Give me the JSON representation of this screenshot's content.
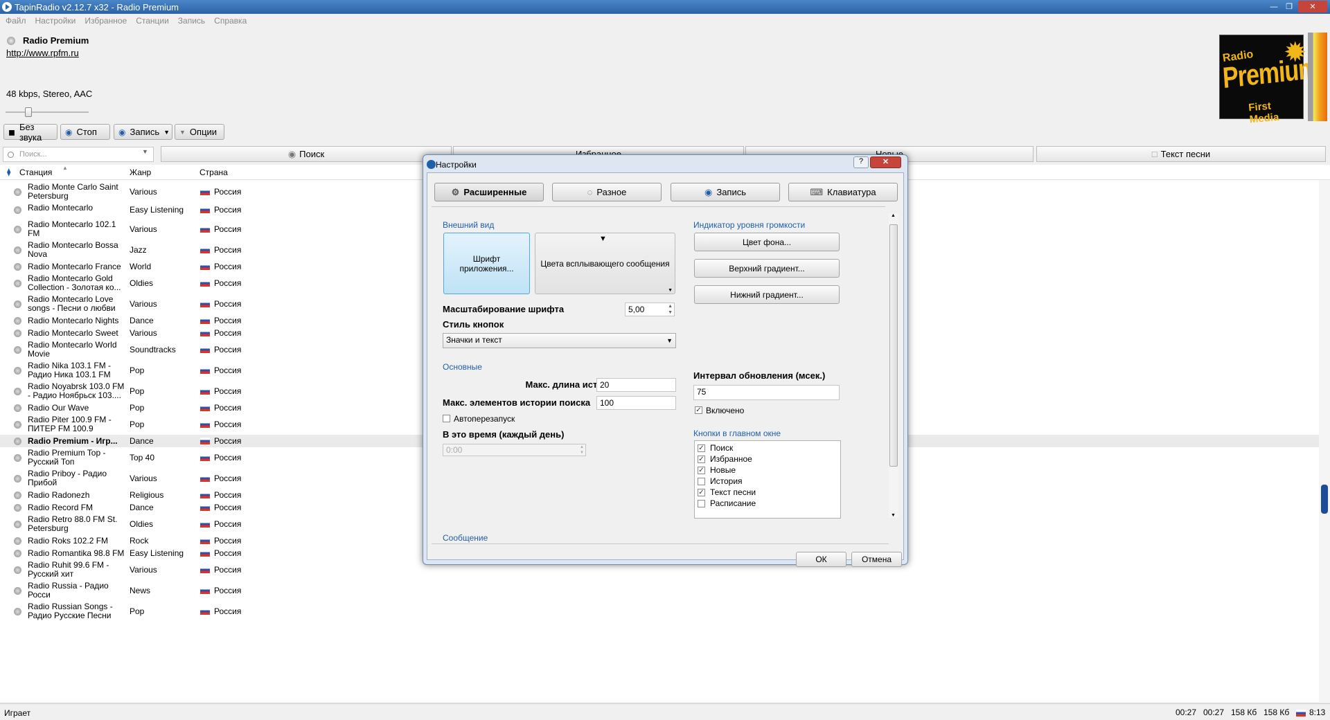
{
  "window": {
    "title": "TapinRadio v2.12.7 x32 - Radio Premium"
  },
  "menu": [
    "Файл",
    "Настройки",
    "Избранное",
    "Станции",
    "Запись",
    "Справка"
  ],
  "station": {
    "name": "Radio Premium",
    "url": "http://www.rpfm.ru",
    "format": "48 kbps, Stereo, AAC"
  },
  "logo": {
    "line1": "Radio",
    "line2": "Premium",
    "line3": "First Media"
  },
  "toolbar": {
    "mute": "Без звука",
    "stop": "Стоп",
    "record": "Запись",
    "options": "Опции"
  },
  "search": {
    "placeholder": "Поиск..."
  },
  "tabs": {
    "search": "Поиск",
    "favorites": "Избранное",
    "new": "Новые",
    "lyrics": "Текст песни"
  },
  "list": {
    "headers": {
      "station": "Станция",
      "genre": "Жанр",
      "country": "Страна"
    },
    "rows": [
      {
        "station": "Radio Monte Carlo Saint Petersburg",
        "genre": "Various",
        "country": "Россия"
      },
      {
        "station": "Radio Montecarlo",
        "genre": "Easy Listening",
        "country": "Россия"
      },
      {
        "station": "Radio Montecarlo 102.1 FM",
        "genre": "Various",
        "country": "Россия"
      },
      {
        "station": "Radio Montecarlo Bossa Nova",
        "genre": "Jazz",
        "country": "Россия"
      },
      {
        "station": "Radio Montecarlo France",
        "genre": "World",
        "country": "Россия"
      },
      {
        "station": "Radio Montecarlo Gold Collection - Золотая ко...",
        "genre": "Oldies",
        "country": "Россия"
      },
      {
        "station": "Radio Montecarlo Love songs - Песни о любви",
        "genre": "Various",
        "country": "Россия"
      },
      {
        "station": "Radio Montecarlo Nights",
        "genre": "Dance",
        "country": "Россия"
      },
      {
        "station": "Radio Montecarlo Sweet",
        "genre": "Various",
        "country": "Россия"
      },
      {
        "station": "Radio Montecarlo World Movie",
        "genre": "Soundtracks",
        "country": "Россия"
      },
      {
        "station": "Radio Nika 103.1 FM - Радио Ника 103.1 FM",
        "genre": "Pop",
        "country": "Россия"
      },
      {
        "station": "Radio Noyabrsk 103.0 FM - Радио Ноябрьск 103....",
        "genre": "Pop",
        "country": "Россия"
      },
      {
        "station": "Radio Our Wave",
        "genre": "Pop",
        "country": "Россия"
      },
      {
        "station": "Radio Piter 100.9 FM - ПИТЕР FM 100.9",
        "genre": "Pop",
        "country": "Россия"
      },
      {
        "station": "Radio Premium - Игр...",
        "genre": "Dance",
        "country": "Россия"
      },
      {
        "station": "Radio Premium Top - Русский Топ",
        "genre": "Top 40",
        "country": "Россия"
      },
      {
        "station": "Radio Priboy - Радио Прибой",
        "genre": "Various",
        "country": "Россия"
      },
      {
        "station": "Radio Radonezh",
        "genre": "Religious",
        "country": "Россия"
      },
      {
        "station": "Radio Record FM",
        "genre": "Dance",
        "country": "Россия"
      },
      {
        "station": "Radio Retro 88.0 FM St. Petersburg",
        "genre": "Oldies",
        "country": "Россия"
      },
      {
        "station": "Radio Roks 102.2 FM",
        "genre": "Rock",
        "country": "Россия"
      },
      {
        "station": "Radio Romantika 98.8 FM",
        "genre": "Easy Listening",
        "country": "Россия"
      },
      {
        "station": "Radio Ruhit 99.6 FM - Русский хит",
        "genre": "Various",
        "country": "Россия"
      },
      {
        "station": "Radio Russia - Радио Росси",
        "genre": "News",
        "country": "Россия"
      },
      {
        "station": "Radio Russian Songs - Радио Русские Песни",
        "genre": "Pop",
        "country": "Россия"
      }
    ]
  },
  "status": {
    "text": "Играет",
    "time1": "00:27",
    "time2": "00:27",
    "size1": "158 Кб",
    "size2": "158 Кб",
    "clock": "8:13"
  },
  "dialog": {
    "title": "Настройки",
    "help": "?",
    "tabs": {
      "advanced": "Расширенные",
      "misc": "Разное",
      "record": "Запись",
      "keyboard": "Клавиатура"
    },
    "appearance": {
      "title": "Внешний вид",
      "font_button": "Шрифт приложения...",
      "popup_colors": "Цвета всплывающего сообщения",
      "font_scale_label": "Масштабирование шрифта",
      "font_scale_value": "5,00",
      "button_style_label": "Стиль кнопок",
      "button_style_value": "Значки и текст"
    },
    "basic": {
      "title": "Основные",
      "history_len_label": "Макс. длина истории",
      "history_len_value": "20",
      "search_history_label": "Макс. элементов истории поиска",
      "search_history_value": "100",
      "autorestart_label": "Автоперезапуск",
      "time_label": "В это время (каждый день)",
      "time_value": "0:00"
    },
    "message_title": "Сообщение",
    "volume": {
      "title": "Индикатор уровня громкости",
      "bg_color": "Цвет фона...",
      "top_gradient": "Верхний градиент...",
      "bottom_gradient": "Нижний градиент...",
      "interval_label": "Интервал обновления (мсек.)",
      "interval_value": "75",
      "enabled_label": "Включено"
    },
    "main_buttons": {
      "title": "Кнопки в главном окне",
      "items": [
        {
          "label": "Поиск",
          "checked": true
        },
        {
          "label": "Избранное",
          "checked": true
        },
        {
          "label": "Новые",
          "checked": true
        },
        {
          "label": "История",
          "checked": false
        },
        {
          "label": "Текст песни",
          "checked": true
        },
        {
          "label": "Расписание",
          "checked": false
        }
      ]
    },
    "ok": "ОК",
    "cancel": "Отмена"
  }
}
